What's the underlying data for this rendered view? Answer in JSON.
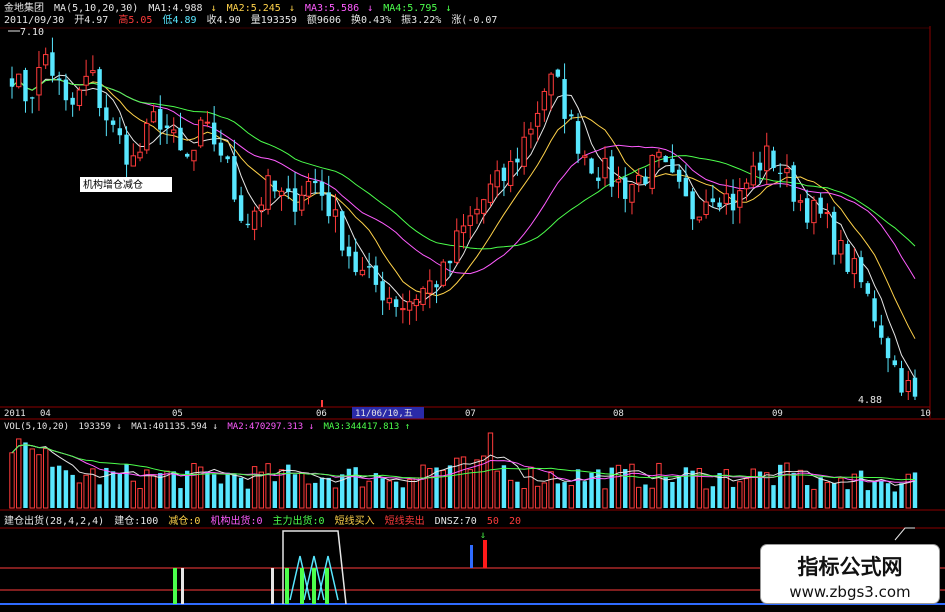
{
  "header": {
    "stock": "金地集团",
    "ma_label": "MA(5,10,20,30)",
    "ma1": "MA1:4.988",
    "ma2": "MA2:5.245",
    "ma3": "MA3:5.586",
    "ma4": "MA4:5.795"
  },
  "quote": {
    "date": "2011/09/30",
    "open": "开4.97",
    "high": "高5.05",
    "low": "低4.89",
    "close": "收4.90",
    "vol": "量193359",
    "amount": "额9606",
    "turnover": "换0.43%",
    "amplitude": "振3.22%",
    "change": "涨(-0.07"
  },
  "price_panel": {
    "top_price": "7.10",
    "bottom_price": "4.88",
    "annotation": "机构增仓减仓"
  },
  "time_axis": {
    "labels": [
      "2011",
      "04",
      "05",
      "06",
      "07",
      "08",
      "09",
      "10"
    ],
    "cursor_label": "11/06/10,五"
  },
  "volume_panel": {
    "label": "VOL(5,10,20)",
    "value": "193359",
    "ma1": "MA1:401135.594",
    "ma2": "MA2:470297.313",
    "ma3": "MA3:344417.813"
  },
  "indicator_panel": {
    "label": "建仓出货(28,4,2,4)",
    "build": "建仓:100",
    "reduce": "减仓:0",
    "inst_out": "机构出货:0",
    "main_out": "主力出货:0",
    "short_buy": "短线买入",
    "short_sell": "短线卖出",
    "dnsz": "DNSZ:70",
    "lvl1": "50",
    "lvl2": "20"
  },
  "watermark": {
    "title": "指标公式网",
    "url": "www.zbgs3.com"
  },
  "colors": {
    "up": "#ff3b3b",
    "down": "#58e7ff",
    "ma_white": "#e6e6e6",
    "ma_yellow": "#ffd24a",
    "ma_magenta": "#ff5cff",
    "ma_green": "#4cff4c"
  },
  "chart_data": {
    "type": "candlestick",
    "x_range": [
      "2011-04",
      "2011-09-30"
    ],
    "price_range": [
      4.88,
      7.1
    ],
    "close_path": [
      6.85,
      6.7,
      6.75,
      6.95,
      6.8,
      6.6,
      6.7,
      6.85,
      6.65,
      6.5,
      6.4,
      6.3,
      6.45,
      6.6,
      6.5,
      6.35,
      6.3,
      6.5,
      6.45,
      6.35,
      6.1,
      5.95,
      6.05,
      6.15,
      6.1,
      6.05,
      6.15,
      6.2,
      6.1,
      5.95,
      5.8,
      5.65,
      5.6,
      5.55,
      5.5,
      5.45,
      5.5,
      5.55,
      5.6,
      5.65,
      5.85,
      5.95,
      6.05,
      6.15,
      6.2,
      6.3,
      6.45,
      6.6,
      6.8,
      6.75,
      6.55,
      6.4,
      6.3,
      6.25,
      6.2,
      6.15,
      6.2,
      6.25,
      6.3,
      6.2,
      6.1,
      6.0,
      6.1,
      6.15,
      6.1,
      6.05,
      6.2,
      6.3,
      6.35,
      6.25,
      6.15,
      6.05,
      6.0,
      5.95,
      5.8,
      5.7,
      5.6,
      5.45,
      5.3,
      5.1,
      4.98,
      4.9
    ]
  }
}
